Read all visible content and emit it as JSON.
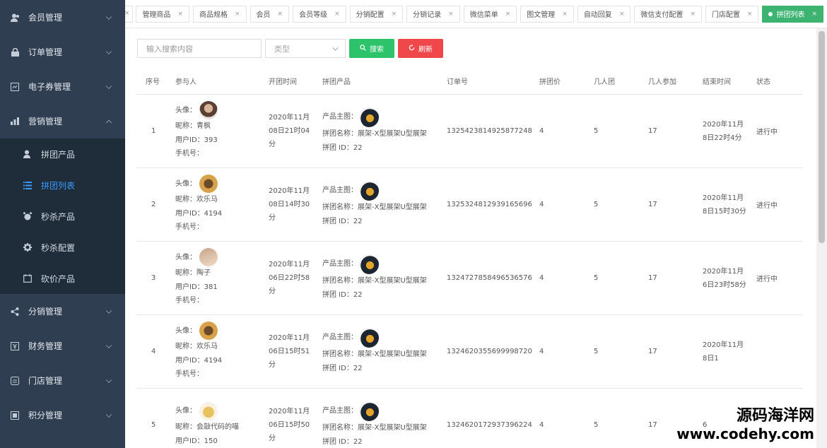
{
  "sidebar": {
    "items": [
      {
        "label": "会员管理",
        "icon": "users-icon"
      },
      {
        "label": "订单管理",
        "icon": "lock-icon"
      },
      {
        "label": "电子券管理",
        "icon": "coupon-icon"
      },
      {
        "label": "营销管理",
        "icon": "chart-icon"
      }
    ],
    "submenu": [
      {
        "label": "拼团产品",
        "icon": "user-icon"
      },
      {
        "label": "拼团列表",
        "icon": "list-icon"
      },
      {
        "label": "秒杀产品",
        "icon": "alarm-icon"
      },
      {
        "label": "秒杀配置",
        "icon": "gear-icon"
      },
      {
        "label": "砍价产品",
        "icon": "calendar-icon"
      }
    ],
    "items_after": [
      {
        "label": "分销管理",
        "icon": "share-icon"
      },
      {
        "label": "财务管理",
        "icon": "finance-icon"
      },
      {
        "label": "门店管理",
        "icon": "store-icon"
      },
      {
        "label": "积分管理",
        "icon": "points-icon"
      }
    ]
  },
  "tabs": [
    "管理商品",
    "商品规格",
    "会员",
    "会员等级",
    "分销配置",
    "分销记录",
    "微信菜单",
    "图文管理",
    "自动回复",
    "微信支付配置",
    "门店配置"
  ],
  "active_tab": "拼团列表",
  "search": {
    "placeholder": "输入搜索内容",
    "type_placeholder": "类型",
    "search_label": "搜索",
    "refresh_label": "刷新"
  },
  "columns": [
    "序号",
    "参与人",
    "开团时间",
    "拼团产品",
    "订单号",
    "拼团价",
    "几人团",
    "几人参加",
    "结束时间",
    "状态"
  ],
  "labels": {
    "avatar": "头像：",
    "nickname": "昵称：",
    "user_id": "用户ID：",
    "phone": "手机号：",
    "prod_img": "产品主图：",
    "prod_name": "拼团名称：",
    "group_id": "拼团 ID："
  },
  "rows": [
    {
      "no": "1",
      "nickname": "青枫",
      "user_id": "393",
      "start": "2020年11月08日21时04分",
      "prod_name": "展架-X型展架U型展架",
      "group_id": "22",
      "order": "1325423814925877248",
      "price": "4",
      "n": "5",
      "join": "17",
      "end": "2020年11月8日22时4分",
      "status": "进行中"
    },
    {
      "no": "2",
      "nickname": "欢乐马",
      "user_id": "4194",
      "start": "2020年11月08日14时30分",
      "prod_name": "展架-X型展架U型展架",
      "group_id": "22",
      "order": "1325324812939165696",
      "price": "4",
      "n": "5",
      "join": "17",
      "end": "2020年11月8日15时30分",
      "status": "进行中"
    },
    {
      "no": "3",
      "nickname": "陶子",
      "user_id": "381",
      "start": "2020年11月06日22时58分",
      "prod_name": "展架-X型展架U型展架",
      "group_id": "22",
      "order": "1324727858496536576",
      "price": "4",
      "n": "5",
      "join": "17",
      "end": "2020年11月6日23时58分",
      "status": "进行中"
    },
    {
      "no": "4",
      "nickname": "欢乐马",
      "user_id": "4194",
      "start": "2020年11月06日15时51分",
      "prod_name": "展架-X型展架U型展架",
      "group_id": "22",
      "order": "1324620355699998720",
      "price": "4",
      "n": "5",
      "join": "17",
      "end": "2020年11月8日1",
      "status": ""
    },
    {
      "no": "5",
      "nickname": "会敲代码的喵",
      "user_id": "150",
      "start": "2020年11月06日15时50分",
      "prod_name": "展架-X型展架U型展架",
      "group_id": "22",
      "order": "1324620172937396224",
      "price": "4",
      "n": "5",
      "join": "17",
      "end": "6",
      "status": ""
    }
  ],
  "watermark": {
    "line1": "源码海洋网",
    "line2": "www.codehy.com"
  }
}
